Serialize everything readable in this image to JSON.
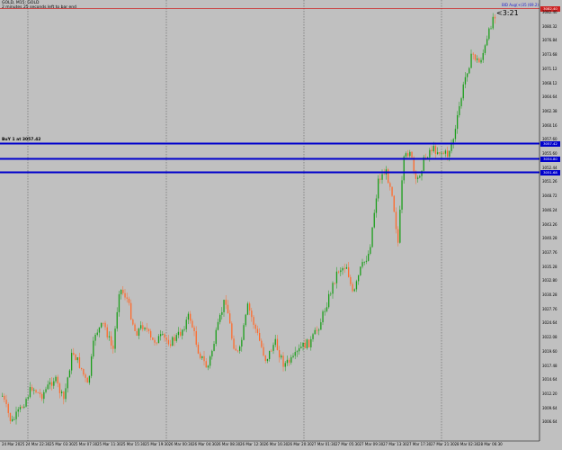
{
  "header": {
    "title": "GOLD, M15: GOLD",
    "countdown_text": "2 minutes 25 seconds left to bar end"
  },
  "chart": {
    "bar_countdown": "<3:21",
    "top_line_label": "BID Aug(+)35 (69.2)",
    "current_price": "3082.40",
    "buy_label": "BuY 1 at 3057.42",
    "price_axis": [
      "3082.40",
      "3080.32",
      "3076.84",
      "3073.68",
      "3071.12",
      "3068.12",
      "3064.64",
      "3062.38",
      "3060.16",
      "3057.60",
      "3055.60",
      "3052.44",
      "3051.26",
      "3048.72",
      "3046.24",
      "3043.26",
      "3040.28",
      "3037.76",
      "3035.28",
      "3032.80",
      "3030.28",
      "3027.76",
      "3024.64",
      "3022.08",
      "3019.60",
      "3017.48",
      "3014.64",
      "3012.20",
      "3009.64",
      "3006.64"
    ],
    "date_axis": [
      "24 Mar 2025",
      "24 Mar 22:30",
      "25 Mar 03:30",
      "25 Mar 07:30",
      "25 Mar 11:30",
      "25 Mar 15:30",
      "25 Mar 19:30",
      "26 Mar 00:30",
      "26 Mar 04:30",
      "26 Mar 08:30",
      "26 Mar 12:30",
      "26 Mar 16:30",
      "26 Mar 20:30",
      "27 Mar 01:30",
      "27 Mar 05:30",
      "27 Mar 09:30",
      "27 Mar 13:30",
      "27 Mar 17:30",
      "27 Mar 21:30",
      "28 Mar 02:30",
      "28 Mar 06:30"
    ],
    "hline_tags": [
      "3057.42",
      "3054.80",
      "3051.68"
    ],
    "colors": {
      "background": "#c0c0c0",
      "bull": "#1a9e1a",
      "bear": "#ff6a2a",
      "hline": "#0000cc",
      "topline": "#cc2222",
      "grid": "#4d4d4d"
    }
  }
}
